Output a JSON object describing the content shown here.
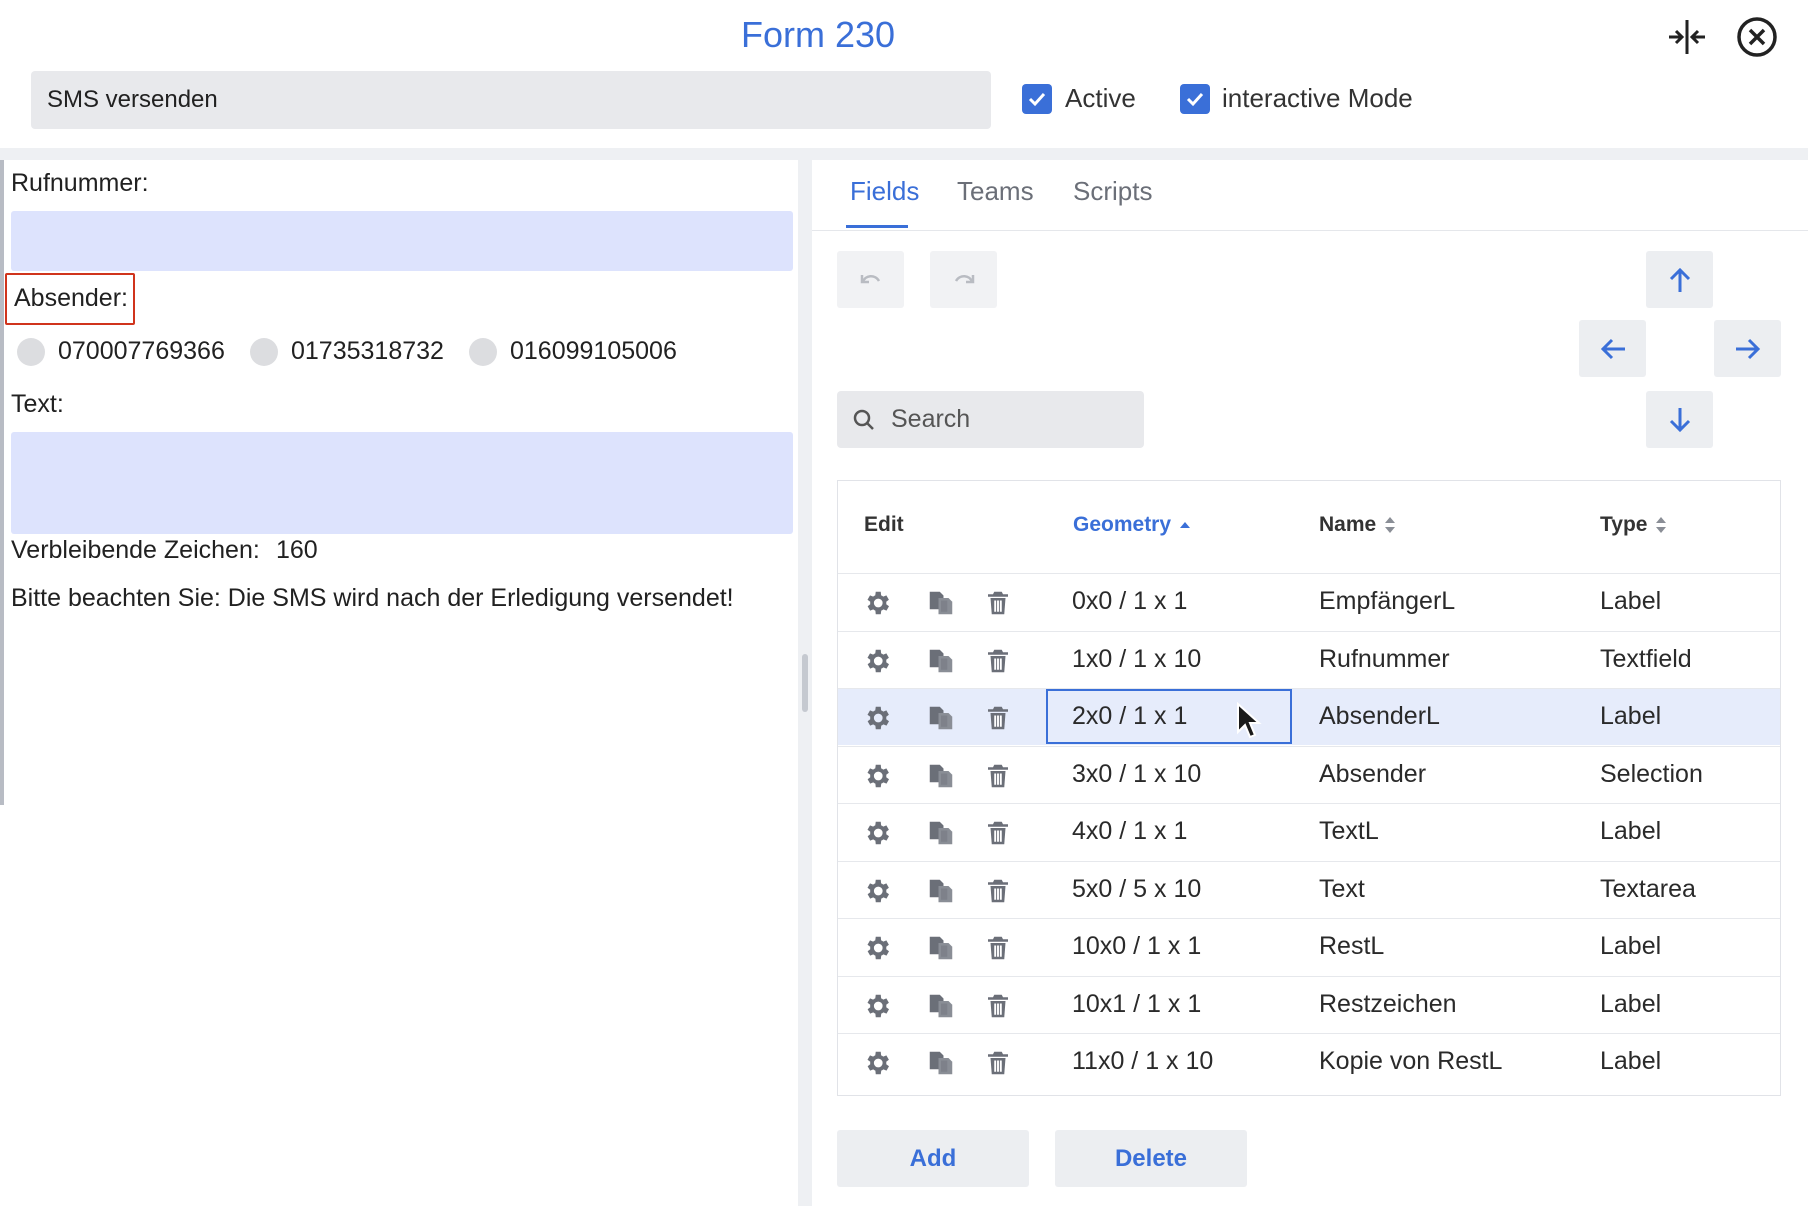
{
  "header": {
    "title": "Form 230",
    "form_name": "SMS versenden",
    "active_label": "Active",
    "active_checked": true,
    "interactive_label": "interactive Mode",
    "interactive_checked": true
  },
  "form_preview": {
    "rufnummer_label": "Rufnummer:",
    "absender_label": "Absender:",
    "radio_options": [
      "070007769366",
      "01735318732",
      "016099105006"
    ],
    "text_label": "Text:",
    "remaining_label": "Verbleibende Zeichen:",
    "remaining_value": "160",
    "notice": "Bitte beachten Sie: Die SMS wird nach der Erledigung versendet!"
  },
  "tabs": [
    {
      "label": "Fields",
      "active": true
    },
    {
      "label": "Teams",
      "active": false
    },
    {
      "label": "Scripts",
      "active": false
    }
  ],
  "search": {
    "placeholder": "Search"
  },
  "table": {
    "headers": {
      "edit": "Edit",
      "geometry": "Geometry",
      "name": "Name",
      "type": "Type"
    },
    "sort_column": "geometry",
    "selected_index": 2,
    "rows": [
      {
        "geometry": "0x0 / 1 x 1",
        "name": "EmpfängerL",
        "type": "Label"
      },
      {
        "geometry": "1x0 / 1 x 10",
        "name": "Rufnummer",
        "type": "Textfield"
      },
      {
        "geometry": "2x0 / 1 x 1",
        "name": "AbsenderL",
        "type": "Label"
      },
      {
        "geometry": "3x0 / 1 x 10",
        "name": "Absender",
        "type": "Selection"
      },
      {
        "geometry": "4x0 / 1 x 1",
        "name": "TextL",
        "type": "Label"
      },
      {
        "geometry": "5x0 / 5 x 10",
        "name": "Text",
        "type": "Textarea"
      },
      {
        "geometry": "10x0 / 1 x 1",
        "name": "RestL",
        "type": "Label"
      },
      {
        "geometry": "10x1 / 1 x 1",
        "name": "Restzeichen",
        "type": "Label"
      },
      {
        "geometry": "11x0 / 1 x 10",
        "name": "Kopie von RestL",
        "type": "Label"
      }
    ]
  },
  "actions": {
    "add": "Add",
    "delete": "Delete"
  },
  "icons": {
    "row_icons": [
      "gear-icon",
      "copy-icon",
      "trash-icon"
    ],
    "nav_icons": [
      "arrow-up-icon",
      "arrow-left-icon",
      "arrow-right-icon",
      "arrow-down-icon"
    ],
    "history_icons": [
      "undo-icon",
      "redo-icon"
    ]
  },
  "colors": {
    "accent": "#3a6fd8",
    "input_bg": "#dde3fd",
    "highlight_border": "#d0341c",
    "selected_row": "#e6ecfb"
  }
}
